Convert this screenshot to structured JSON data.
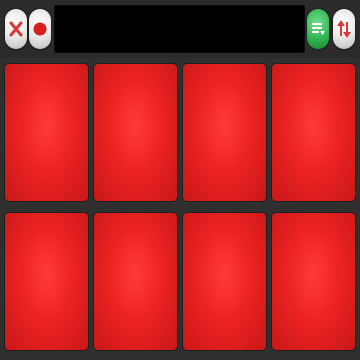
{
  "toolbar": {
    "buttons": [
      {
        "name": "clear-button",
        "icon": "close-icon"
      },
      {
        "name": "record-button",
        "icon": "record-icon"
      },
      {
        "name": "list-button",
        "icon": "list-icon"
      },
      {
        "name": "sort-button",
        "icon": "swap-vertical-icon"
      }
    ],
    "display_text": ""
  },
  "pads": {
    "color": "#e82424",
    "count": 8
  }
}
